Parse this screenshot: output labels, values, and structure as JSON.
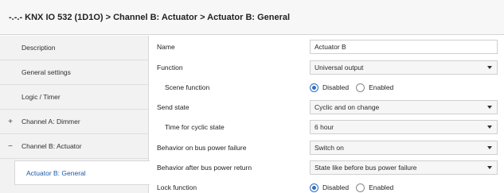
{
  "window": {
    "title": "-.-.- KNX IO 532 (1D1O) > Channel B: Actuator > Actuator B: General"
  },
  "sidebar": {
    "items": [
      {
        "label": "Description",
        "expander": ""
      },
      {
        "label": "General settings",
        "expander": ""
      },
      {
        "label": "Logic / Timer",
        "expander": ""
      },
      {
        "label": "Channel A: Dimmer",
        "expander": "+"
      },
      {
        "label": "Channel B: Actuator",
        "expander": "−"
      },
      {
        "label": "Actuator B: General",
        "expander": "",
        "selected": true
      }
    ]
  },
  "params": {
    "name": {
      "label": "Name",
      "value": "Actuator B"
    },
    "function": {
      "label": "Function",
      "value": "Universal output"
    },
    "scene_function": {
      "label": "Scene function",
      "options": [
        "Disabled",
        "Enabled"
      ],
      "selected": "Disabled"
    },
    "send_state": {
      "label": "Send state",
      "value": "Cyclic and on change"
    },
    "time_cyclic": {
      "label": "Time for cyclic state",
      "value": "6 hour"
    },
    "bus_failure": {
      "label": "Behavior on bus power failure",
      "value": "Switch on"
    },
    "bus_return": {
      "label": "Behavior after bus power return",
      "value": "State like before bus power failure"
    },
    "lock_function": {
      "label": "Lock function",
      "options": [
        "Disabled",
        "Enabled"
      ],
      "selected": "Disabled"
    }
  },
  "colors": {
    "accent": "#2e6fc0",
    "selected_text": "#1a5aa6",
    "sidebar_bg": "#f2f2f2",
    "titlebar_bg": "#f7f7f7"
  }
}
